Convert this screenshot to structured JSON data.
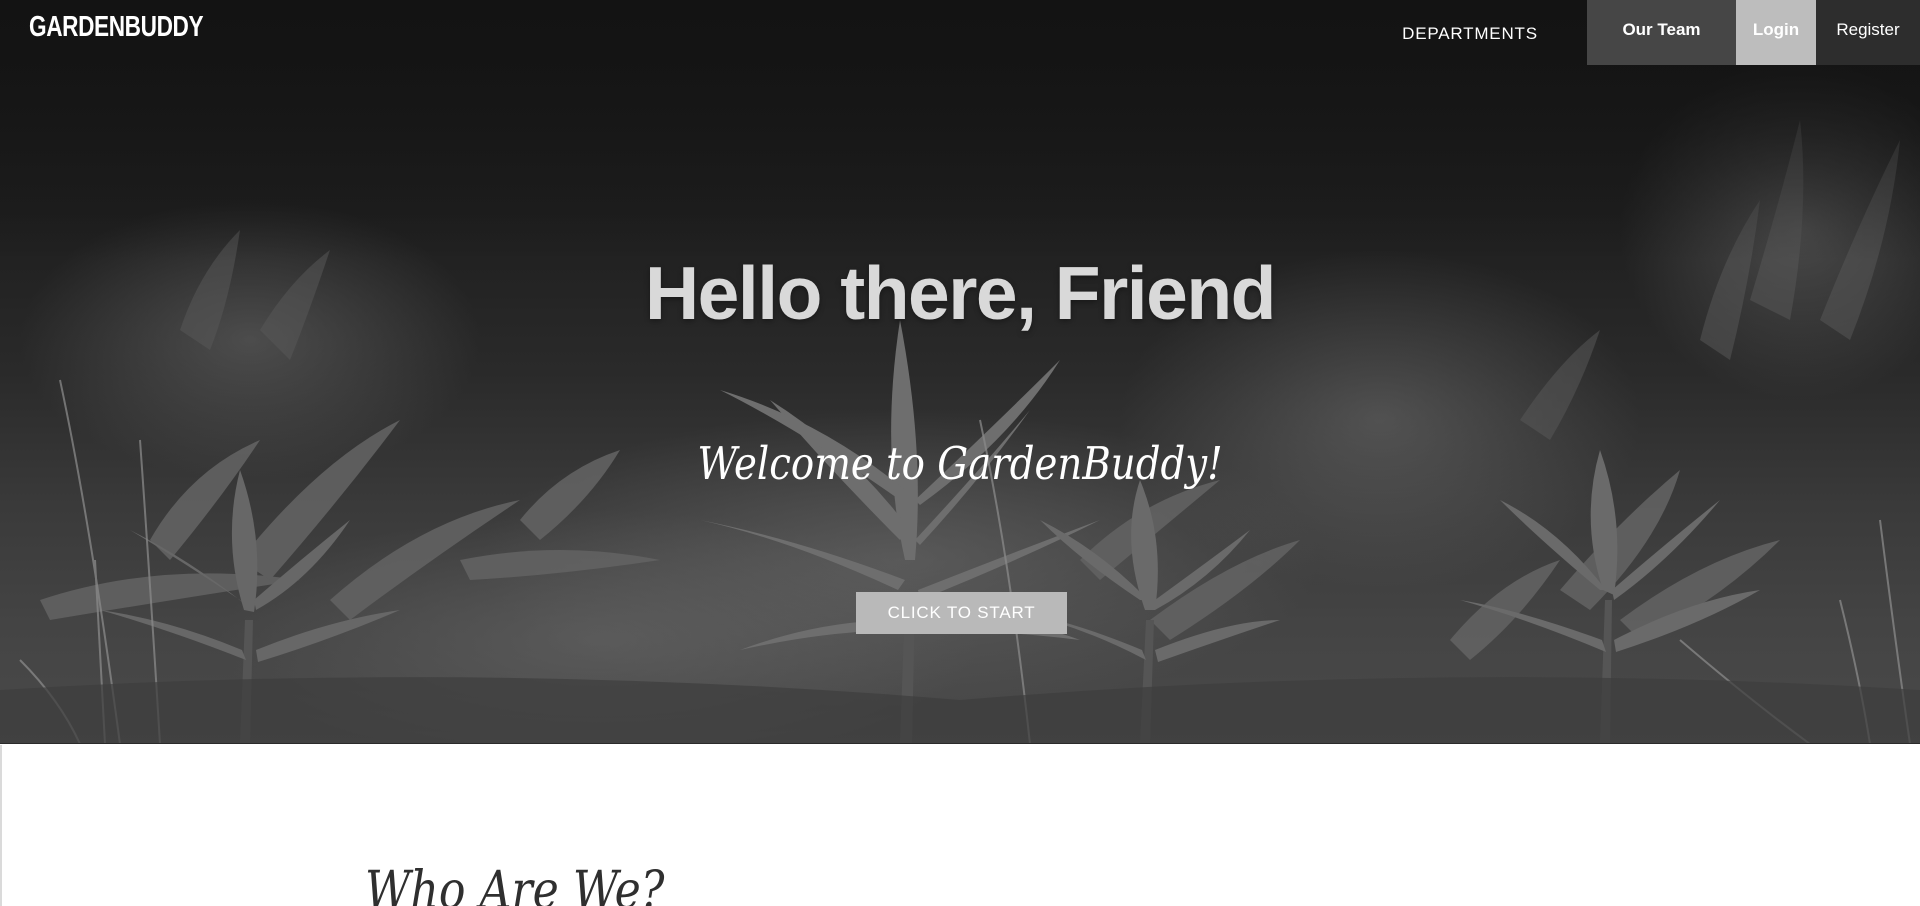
{
  "brand": {
    "logo_text": "GARDENBUDDY"
  },
  "nav": {
    "departments_label": "DEPARTMENTS",
    "team_label": "Our Team",
    "login_label": "Login",
    "register_label": "Register"
  },
  "hero": {
    "title": "Hello there, Friend",
    "subtitle": "Welcome to GardenBuddy!",
    "cta_label": "CLICK TO START"
  },
  "about": {
    "heading": "Who Are We?"
  },
  "colors": {
    "hero_dark": "#1b1b1b",
    "team_bg": "#464646",
    "login_bg": "#bdbdbd",
    "register_bg": "#2d2d2d",
    "cta_bg": "#b9b9b9",
    "title_text": "#d9d9d9"
  },
  "icons": {
    "hero_background": "plants-photo-background"
  }
}
